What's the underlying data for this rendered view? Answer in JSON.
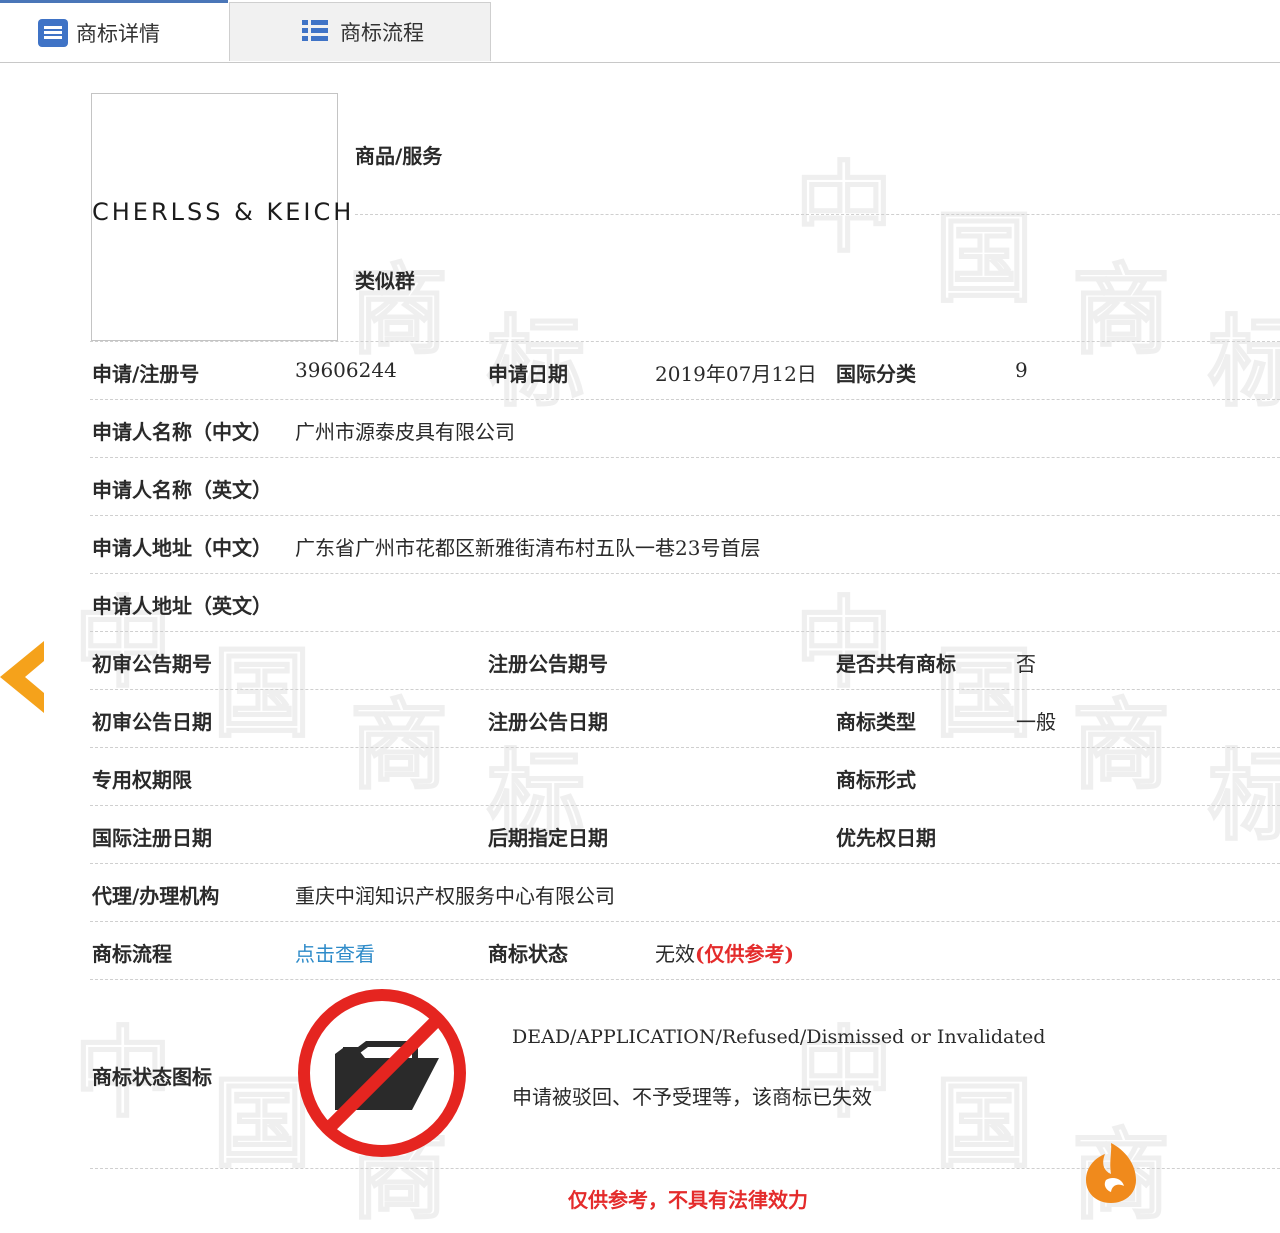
{
  "tabs": {
    "detail": "商标详情",
    "flow": "商标流程"
  },
  "watermark": [
    "中",
    "国",
    "商",
    "标"
  ],
  "logo": {
    "text": "CHERLSS & KEICH"
  },
  "goods": {
    "label": "商品/服务",
    "value": ""
  },
  "similar_group": {
    "label": "类似群",
    "value": ""
  },
  "fields": {
    "reg_no": {
      "label": "申请/注册号",
      "value": "39606244"
    },
    "apply_date": {
      "label": "申请日期",
      "value": "2019年07月12日"
    },
    "intl_class": {
      "label": "国际分类",
      "value": "9"
    },
    "applicant_cn": {
      "label": "申请人名称（中文）",
      "value": "广州市源泰皮具有限公司"
    },
    "applicant_en": {
      "label": "申请人名称（英文）",
      "value": ""
    },
    "address_cn": {
      "label": "申请人地址（中文）",
      "value": "广东省广州市花都区新雅街清布村五队一巷23号首层"
    },
    "address_en": {
      "label": "申请人地址（英文）",
      "value": ""
    },
    "prelim_issue": {
      "label": "初审公告期号",
      "value": ""
    },
    "reg_issue": {
      "label": "注册公告期号",
      "value": ""
    },
    "shared": {
      "label": "是否共有商标",
      "value": "否"
    },
    "prelim_date": {
      "label": "初审公告日期",
      "value": ""
    },
    "reg_date": {
      "label": "注册公告日期",
      "value": ""
    },
    "tm_type": {
      "label": "商标类型",
      "value": "一般"
    },
    "exclusive_period": {
      "label": "专用权期限",
      "value": ""
    },
    "tm_form": {
      "label": "商标形式",
      "value": ""
    },
    "intl_reg_date": {
      "label": "国际注册日期",
      "value": ""
    },
    "later_designation": {
      "label": "后期指定日期",
      "value": ""
    },
    "priority_date": {
      "label": "优先权日期",
      "value": ""
    },
    "agency": {
      "label": "代理/办理机构",
      "value": "重庆中润知识产权服务中心有限公司"
    },
    "process": {
      "label": "商标流程",
      "value": "点击查看"
    },
    "status": {
      "label": "商标状态",
      "value": "无效",
      "note": "(仅供参考)"
    },
    "status_icon": {
      "label": "商标状态图标",
      "english": "DEAD/APPLICATION/Refused/Dismissed or Invalidated",
      "chinese": "申请被驳回、不予受理等，该商标已失效"
    }
  },
  "footer_note": "仅供参考，不具有法律效力",
  "colors": {
    "accent": "#3f73c6",
    "link": "#2e8bc9",
    "warning": "#e42b2b",
    "arrow": "#f5a21b"
  }
}
